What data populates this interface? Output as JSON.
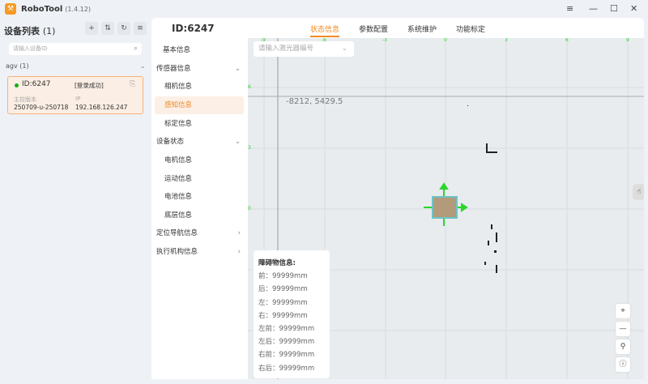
{
  "app": {
    "title": "RoboTool",
    "version": "(1.4.12)"
  },
  "sidebar": {
    "title": "设备列表",
    "count": "(1)",
    "search_placeholder": "请输入设备ID",
    "group": "agv (1)",
    "device": {
      "id": "ID:6247",
      "status": "[登录成功]",
      "version_label": "主控版本",
      "version": "250709-u-250718",
      "ip_label": "IP",
      "ip": "192.168.126.247",
      "status_color": "#1aad19"
    }
  },
  "header": {
    "device_id": "ID:6247",
    "tabs": [
      "状态信息",
      "参数配置",
      "系统维护",
      "功能标定"
    ]
  },
  "menu": {
    "items": [
      "基本信息",
      "传感器信息",
      "相机信息",
      "感知信息",
      "标定信息",
      "设备状态",
      "电机信息",
      "运动信息",
      "电池信息",
      "底层信息",
      "定位导航信息",
      "执行机构信息"
    ]
  },
  "map": {
    "laser_placeholder": "请输入激光器编号",
    "coords": "-8212, 5429.5",
    "x_ticks": [
      "-9",
      "-6",
      "-3",
      "0",
      "3",
      "6",
      "9"
    ],
    "y_ticks": [
      "6",
      "3",
      "0"
    ]
  },
  "obstacle": {
    "title": "障碍物信息:",
    "rows": [
      "前：99999mm",
      "后：99999mm",
      "左：99999mm",
      "右：99999mm",
      "左前：99999mm",
      "左后：99999mm",
      "右前：99999mm",
      "右后：99999mm"
    ]
  }
}
